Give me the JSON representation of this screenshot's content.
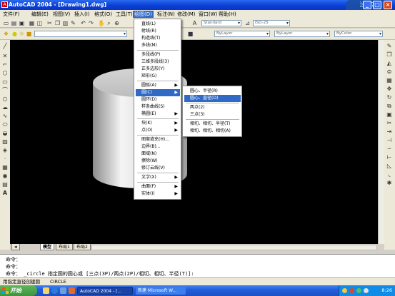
{
  "window": {
    "title": "AutoCAD 2004 - [Drawing1.dwg]",
    "app_icon_glyph": "A",
    "minimize_glyph": "_",
    "maximize_glyph": "□",
    "close_glyph": "×",
    "watermark": "注册7"
  },
  "menubar": {
    "items": [
      {
        "label": "文件(F)"
      },
      {
        "label": "编辑(E)"
      },
      {
        "label": "视图(V)"
      },
      {
        "label": "插入(I)"
      },
      {
        "label": "格式(O)"
      },
      {
        "label": "工具(T)"
      },
      {
        "label": "绘图(D)"
      },
      {
        "label": "标注(N)"
      },
      {
        "label": "修改(M)"
      },
      {
        "label": "窗口(W)"
      },
      {
        "label": "帮助(H)"
      }
    ]
  },
  "toolbars": {
    "style_combo": "Standard",
    "dim_style_combo": "ISO-25",
    "linetype_combo": "ByLayer",
    "lineweight_combo": "ByLayer",
    "color_combo": "ByColor"
  },
  "draw_menu": {
    "items": [
      {
        "label": "直线(L)"
      },
      {
        "label": "射线(R)"
      },
      {
        "label": "构造线(T)"
      },
      {
        "label": "多线(M)"
      },
      {
        "label": "多段线(P)"
      },
      {
        "label": "三维多段线(3)"
      },
      {
        "label": "正多边形(Y)"
      },
      {
        "label": "矩形(G)"
      },
      {
        "label": "圆弧(A)"
      },
      {
        "label": "圆(C)"
      },
      {
        "label": "圆环(D)"
      },
      {
        "label": "样条曲线(S)"
      },
      {
        "label": "椭圆(E)"
      },
      {
        "label": "块(K)"
      },
      {
        "label": "点(O)"
      },
      {
        "label": "图案填充(H)..."
      },
      {
        "label": "边界(B)..."
      },
      {
        "label": "面域(N)"
      },
      {
        "label": "擦除(W)"
      },
      {
        "label": "修订云线(V)"
      },
      {
        "label": "文字(X)"
      },
      {
        "label": "曲面(F)"
      },
      {
        "label": "实体(I)"
      }
    ],
    "submenu_arrow": "▶"
  },
  "circle_submenu": {
    "items": [
      {
        "label": "圆心、半径(R)"
      },
      {
        "label": "圆心、直径(D)"
      },
      {
        "label": "两点(2)"
      },
      {
        "label": "三点(3)"
      },
      {
        "label": "相切、相切、半径(T)"
      },
      {
        "label": "相切、相切、相切(A)"
      }
    ]
  },
  "layout_tabs": [
    {
      "label": "模型"
    },
    {
      "label": "布局1"
    },
    {
      "label": "布局2"
    }
  ],
  "command": {
    "lines": [
      "命令：",
      "命令：",
      "命令：  _circle 指定圆的圆心或 [三点(3P)/两点(2P)/相切、相切、半径(T)]:"
    ]
  },
  "statusbar": {
    "text": "用指定直径创建圆",
    "command": "CIRCLE"
  },
  "taskbar": {
    "start_label": "开始",
    "tasks": [
      {
        "label": "AutoCAD 2004 - [..."
      },
      {
        "label": "新建 Microsoft W..."
      }
    ],
    "clock": "8:26"
  },
  "colors": {
    "title_blue": "#0a3fd6",
    "menu_highlight": "#316ac5",
    "viewport_bg": "#000000",
    "taskbar_blue": "#245edb",
    "start_green": "#3a963a"
  }
}
